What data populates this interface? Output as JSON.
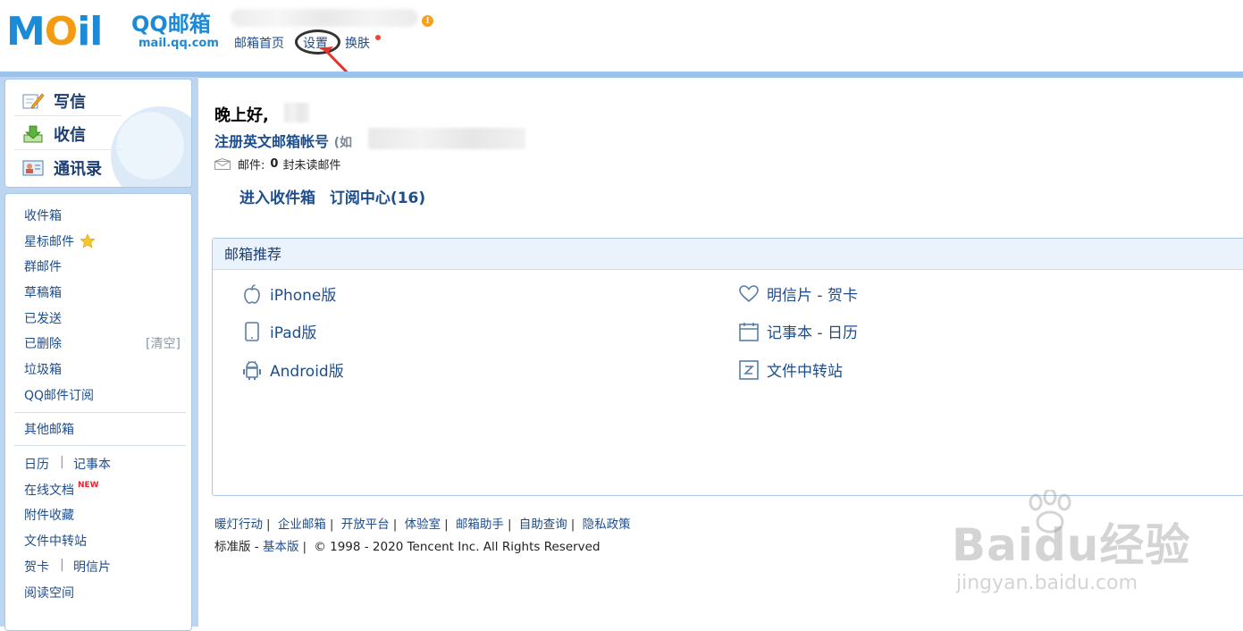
{
  "header": {
    "logo_text": "MOil",
    "brand": "QQ邮箱",
    "domain": "mail.qq.com",
    "nav": [
      {
        "label": "邮箱首页"
      },
      {
        "label": "设置"
      },
      {
        "label": "换肤"
      }
    ]
  },
  "sidebar": {
    "quick_actions": [
      {
        "label": "写信",
        "icon": "compose-icon"
      },
      {
        "label": "收信",
        "icon": "inbox-download-icon"
      },
      {
        "label": "通讯录",
        "icon": "contacts-icon"
      }
    ],
    "folders": {
      "inbox": "收件箱",
      "starred": "星标邮件",
      "group": "群邮件",
      "drafts": "草稿箱",
      "sent": "已发送",
      "deleted": "已删除",
      "empty_trash": "[清空]",
      "spam": "垃圾箱",
      "subscriptions": "QQ邮件订阅",
      "other_mailbox": "其他邮箱",
      "calendar": "日历",
      "notepad": "记事本",
      "online_docs": "在线文档",
      "new_badge": "NEW",
      "attachments": "附件收藏",
      "file_transfer": "文件中转站",
      "cards": "贺卡",
      "postcards": "明信片",
      "reading_space": "阅读空间"
    }
  },
  "main": {
    "greeting": "晚上好,",
    "register_link": "注册英文邮箱帐号",
    "register_hint": "(如",
    "mail_label": "邮件:",
    "unread_count": "0",
    "unread_suffix": "封未读邮件",
    "enter_inbox": "进入收件箱",
    "subscription_center": "订阅中心(16)",
    "recommend": {
      "title": "邮箱推荐",
      "left": [
        {
          "label": "iPhone版",
          "icon": "apple-icon"
        },
        {
          "label": "iPad版",
          "icon": "tablet-icon"
        },
        {
          "label": "Android版",
          "icon": "android-icon"
        }
      ],
      "right": [
        {
          "label": "明信片 - 贺卡",
          "icon": "heart-icon"
        },
        {
          "label": "记事本 - 日历",
          "icon": "calendar-icon"
        },
        {
          "label": "文件中转站",
          "icon": "file-transfer-icon"
        }
      ]
    },
    "footer": {
      "links": [
        "暖灯行动",
        "企业邮箱",
        "开放平台",
        "体验室",
        "邮箱助手",
        "自助查询",
        "隐私政策"
      ],
      "standard": "标准版",
      "dash": "-",
      "basic": "基本版",
      "copyright": "© 1998 - 2020 Tencent Inc. All Rights Reserved"
    }
  },
  "watermark": {
    "brand": "Baidu经验",
    "site": "jingyan.baidu.com"
  },
  "colors": {
    "accent": "#1c8ad6",
    "link": "#1e4d8c",
    "sidebar_bg": "#bcd6f2"
  }
}
